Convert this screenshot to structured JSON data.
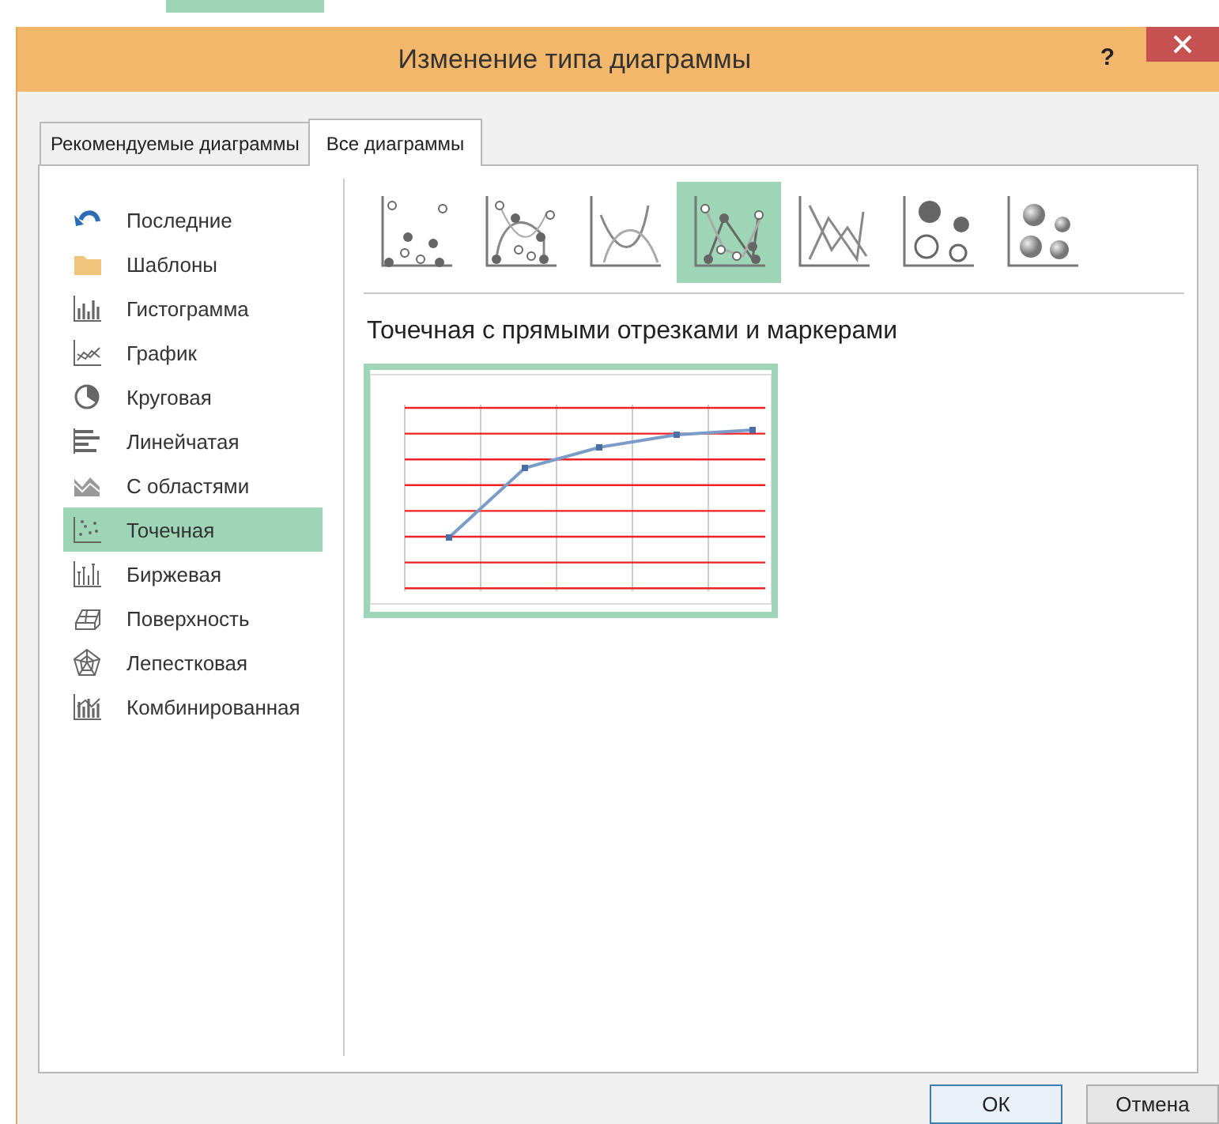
{
  "window": {
    "title": "Изменение типа диаграммы",
    "help": "?"
  },
  "tabs": [
    {
      "label": "Рекомендуемые диаграммы",
      "selected": false
    },
    {
      "label": "Все диаграммы",
      "selected": true
    }
  ],
  "sidebar": {
    "items": [
      {
        "label": "Последние",
        "selected": false
      },
      {
        "label": "Шаблоны",
        "selected": false
      },
      {
        "label": "Гистограмма",
        "selected": false
      },
      {
        "label": "График",
        "selected": false
      },
      {
        "label": "Круговая",
        "selected": false
      },
      {
        "label": "Линейчатая",
        "selected": false
      },
      {
        "label": "С областями",
        "selected": false
      },
      {
        "label": "Точечная",
        "selected": true
      },
      {
        "label": "Биржевая",
        "selected": false
      },
      {
        "label": "Поверхность",
        "selected": false
      },
      {
        "label": "Лепестковая",
        "selected": false
      },
      {
        "label": "Комбинированная",
        "selected": false
      }
    ]
  },
  "subtypes": [
    {
      "selected": false
    },
    {
      "selected": false
    },
    {
      "selected": false
    },
    {
      "selected": true
    },
    {
      "selected": false
    },
    {
      "selected": false
    },
    {
      "selected": false
    }
  ],
  "subtype_title": "Точечная с прямыми отрезками и маркерами",
  "buttons": [
    {
      "label": "ОК",
      "default": true
    },
    {
      "label": "Отмена",
      "default": false
    }
  ]
}
